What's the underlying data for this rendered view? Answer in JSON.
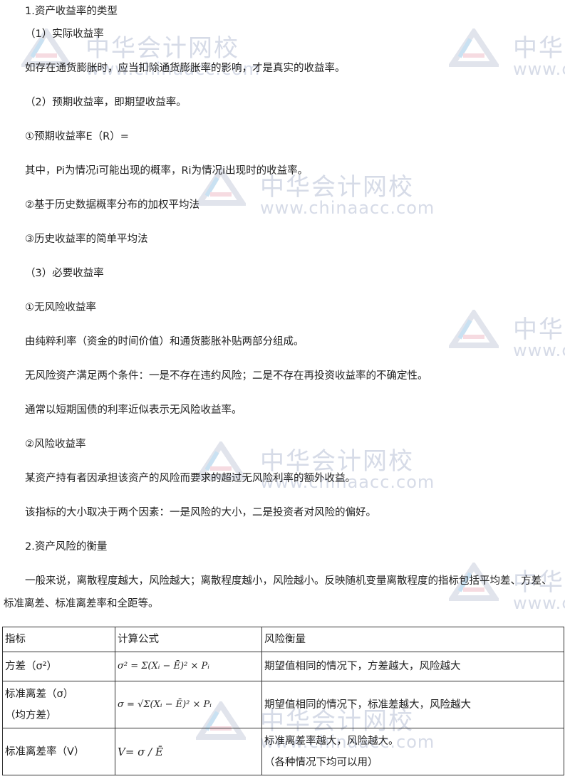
{
  "lines": [
    "1.资产收益率的类型",
    "（1）实际收益率",
    "如存在通货膨胀时，应当扣除通货膨胀率的影响，才是真实的收益率。",
    "（2）预期收益率，即期望收益率。",
    "①预期收益率E（R）=",
    "其中，Pi为情况i可能出现的概率，Ri为情况i出现时的收益率。",
    "②基于历史数据概率分布的加权平均法",
    "③历史收益率的简单平均法",
    "（3）必要收益率",
    "①无风险收益率",
    "由纯粹利率（资金的时间价值）和通货膨胀补贴两部分组成。",
    "无风险资产满足两个条件：一是不存在违约风险；二是不存在再投资收益率的不确定性。",
    "通常以短期国债的利率近似表示无风险收益率。",
    "②风险收益率",
    "某资产持有者因承担该资产的风险而要求的超过无风险利率的额外收益。",
    "该指标的大小取决于两个因素：一是风险的大小，二是投资者对风险的偏好。",
    "2.资产风险的衡量"
  ],
  "paragraph": "一般来说，离散程度越大，风险越大；离散程度越小，风险越小。反映随机变量离散程度的指标包括平均差、方差、标准离差、标准离差率和全距等。",
  "table": {
    "headers": [
      "指标",
      "计算公式",
      "风险衡量"
    ],
    "rows": [
      {
        "name": "方差（σ²）",
        "formula": "σ² = Σ(Xᵢ − Ē)² × Pᵢ",
        "measure": "期望值相同的情况下，方差越大，风险越大"
      },
      {
        "name": "标准离差（σ）",
        "name2": "（均方差）",
        "formula": "σ = √Σ(Xᵢ − Ē)² × Pᵢ",
        "measure": "期望值相同的情况下，标准差越大，风险越大"
      },
      {
        "name": "标准离差率（V）",
        "formula": "V= σ / Ē",
        "measure": "标准离差率越大，风险越大。",
        "measure2": "（各种情况下均可以用）"
      }
    ]
  },
  "watermark": {
    "title": "中华会计网校",
    "url": "www.chinaacc.com"
  }
}
